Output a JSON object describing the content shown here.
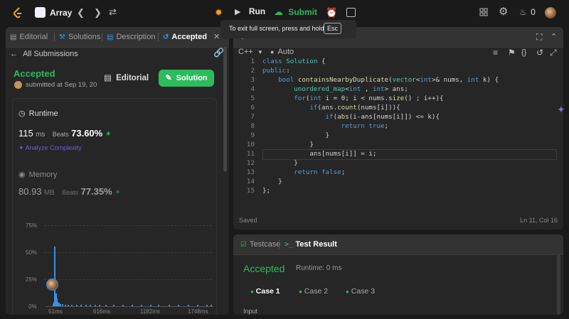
{
  "topbar": {
    "problem_list": "Array",
    "run": "Run",
    "submit": "Submit",
    "coins": "0"
  },
  "tooltip": {
    "text": "To exit full screen, press and hold",
    "key": "Esc"
  },
  "left_tabs": [
    {
      "label": "Editorial"
    },
    {
      "label": "Solutions"
    },
    {
      "label": "Description"
    },
    {
      "label": "Accepted"
    }
  ],
  "submission": {
    "back_label": "All Submissions",
    "status": "Accepted",
    "submitted": "submitted at Sep 19, 20",
    "editorial_btn": "Editorial",
    "solution_btn": "Solution"
  },
  "runtime": {
    "title": "Runtime",
    "value": "115",
    "unit": "ms",
    "beats_label": "Beats",
    "beats": "73.60%",
    "analyze": "Analyze Complexity"
  },
  "memory": {
    "title": "Memory",
    "value": "80.93",
    "unit": "MB",
    "beats_label": "Beats",
    "beats": "77.35%"
  },
  "chart_data": {
    "type": "bar",
    "yticks": [
      "75%",
      "50%",
      "25%",
      "0%"
    ],
    "xticks": [
      "51ms",
      "616ms",
      "1182ms",
      "1748ms"
    ],
    "ylim": [
      0,
      85
    ],
    "x": [
      51,
      60,
      70,
      80,
      90,
      100,
      115,
      130,
      150,
      180,
      210,
      250,
      300,
      350,
      400,
      450,
      500,
      550,
      616,
      700,
      800,
      900,
      1000,
      1100,
      1182,
      1300,
      1400,
      1500,
      1600,
      1700,
      1748
    ],
    "values": [
      2,
      4,
      55,
      12,
      7,
      4,
      3,
      2,
      2,
      1,
      1,
      1,
      1,
      1,
      1,
      1,
      1,
      1,
      1,
      1,
      1,
      1,
      1,
      1,
      1,
      1,
      1,
      1,
      1,
      1,
      1
    ]
  },
  "editor": {
    "language": "C++",
    "mode": "Auto",
    "saved": "Saved",
    "cursor": "Ln 11, Col 16",
    "lines": [
      {
        "n": "1",
        "t": "class Solution {"
      },
      {
        "n": "2",
        "t": "public:"
      },
      {
        "n": "3",
        "t": "    bool containsNearbyDuplicate(vector<int>& nums, int k) {"
      },
      {
        "n": "4",
        "t": "        unordered_map<int , int> ans;"
      },
      {
        "n": "5",
        "t": "        for(int i = 0; i < nums.size() ; i++){"
      },
      {
        "n": "6",
        "t": "            if(ans.count(nums[i])){"
      },
      {
        "n": "7",
        "t": "                if(abs(i-ans[nums[i]]) <= k){"
      },
      {
        "n": "8",
        "t": "                    return true;"
      },
      {
        "n": "9",
        "t": "                }"
      },
      {
        "n": "10",
        "t": "            }"
      },
      {
        "n": "11",
        "t": "            ans[nums[i]] = i;"
      },
      {
        "n": "12",
        "t": "        }"
      },
      {
        "n": "13",
        "t": "        return false;"
      },
      {
        "n": "14",
        "t": "    }"
      },
      {
        "n": "15",
        "t": "};"
      }
    ]
  },
  "console": {
    "testcase_tab": "Testcase",
    "result_tab": "Test Result",
    "status": "Accepted",
    "runtime": "Runtime: 0 ms",
    "cases": [
      "Case 1",
      "Case 2",
      "Case 3"
    ],
    "input_label": "Input"
  },
  "colors": {
    "accent_green": "#2cbb5d",
    "bg": "#1a1a1a",
    "panel": "#262626",
    "bar": "#3a8fe3"
  }
}
